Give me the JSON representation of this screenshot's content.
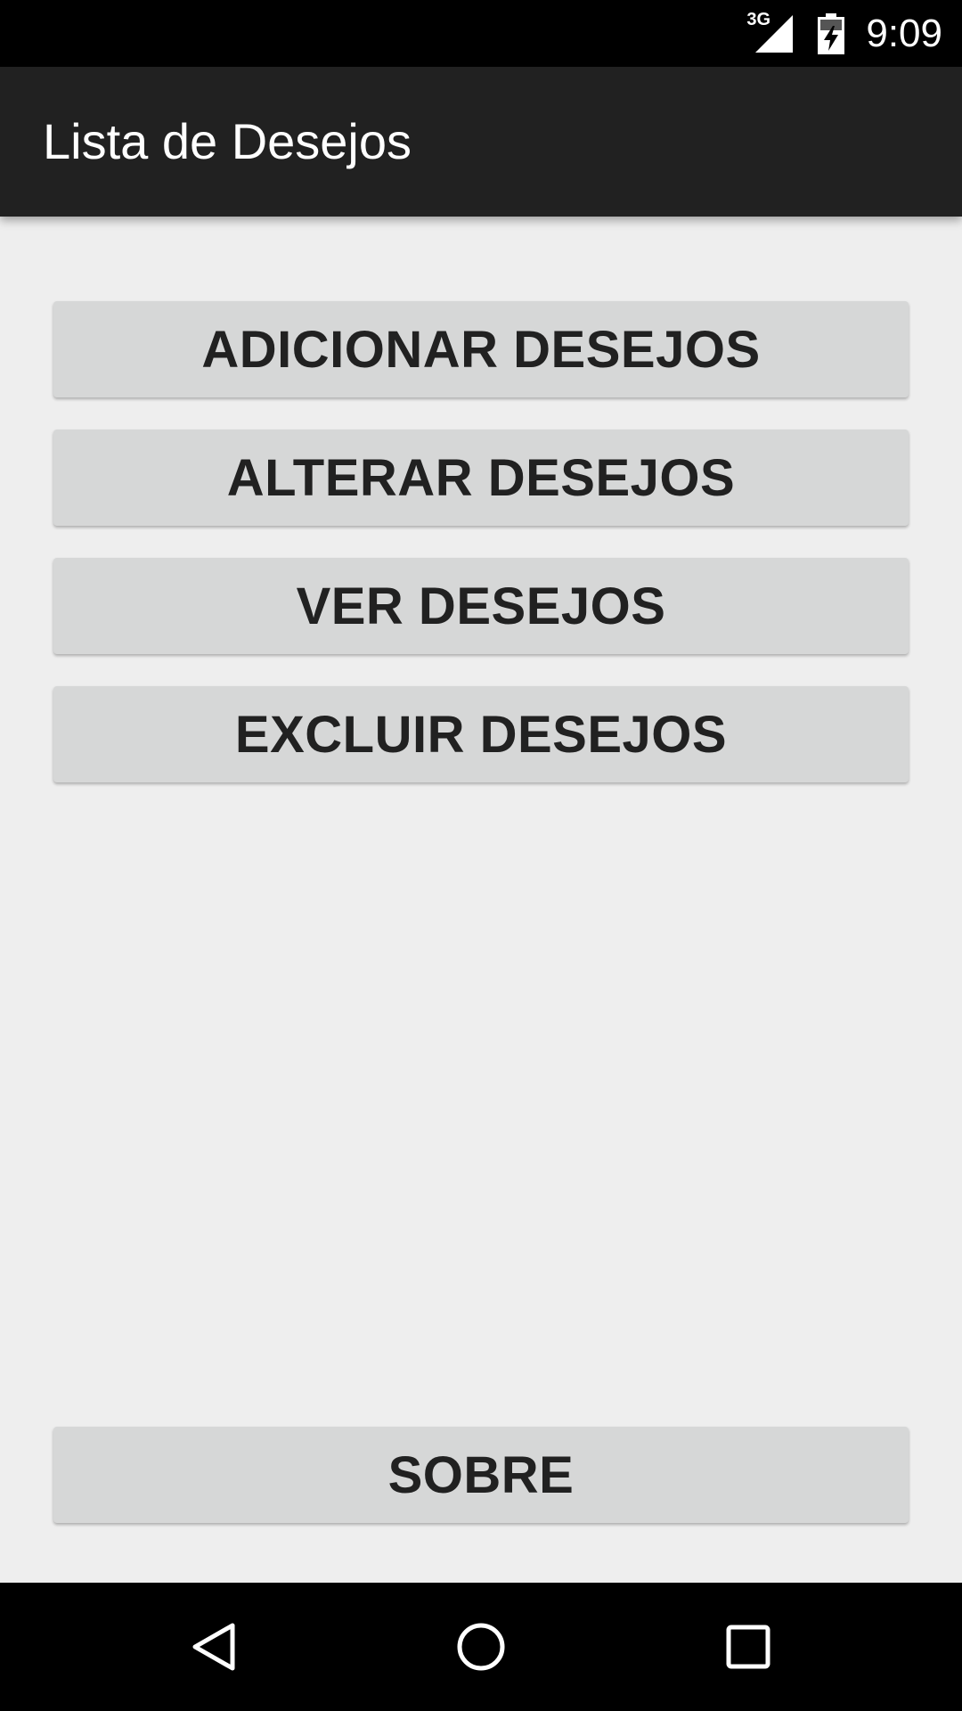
{
  "status_bar": {
    "network_label": "3G",
    "time": "9:09",
    "signal_icon": "signal-icon",
    "battery_icon": "battery-charging-icon"
  },
  "app_bar": {
    "title": "Lista de Desejos"
  },
  "main": {
    "buttons": [
      {
        "label": "ADICIONAR DESEJOS"
      },
      {
        "label": "ALTERAR DESEJOS"
      },
      {
        "label": "VER DESEJOS"
      },
      {
        "label": "EXCLUIR DESEJOS"
      }
    ],
    "about_button": {
      "label": "SOBRE"
    }
  },
  "nav_bar": {
    "back_icon": "back-icon",
    "home_icon": "home-icon",
    "recents_icon": "recents-icon"
  },
  "colors": {
    "app_bar": "#212121",
    "background": "#eeeeee",
    "button": "#d6d7d7",
    "button_text": "#212121"
  }
}
